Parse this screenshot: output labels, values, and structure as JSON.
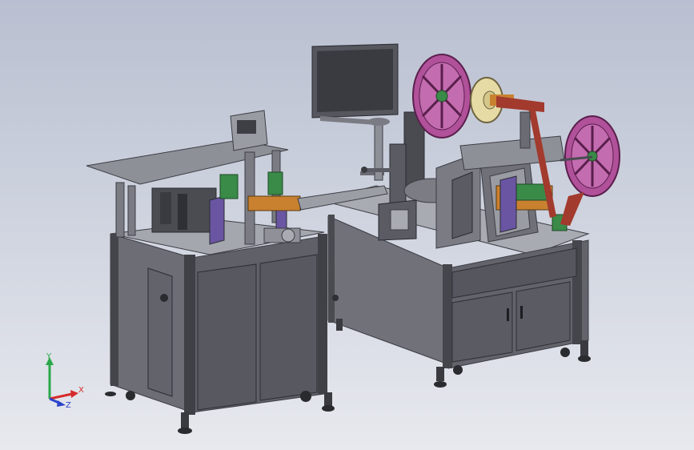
{
  "viewport": {
    "background_top": "#b9bfd0",
    "background_bottom": "#e7e9ee"
  },
  "model": {
    "body_color": "#6f7078",
    "frame_color": "#43444a",
    "reel_color": "#b0519a",
    "tape_color": "#e6dba5",
    "accent_orange": "#c9812f",
    "accent_purple": "#6a55a3",
    "accent_green": "#3a8a48",
    "accent_red": "#a23a2d"
  },
  "triad": {
    "x_label": "X",
    "y_label": "Y",
    "z_label": "Z",
    "x_color": "#d62b2b",
    "y_color": "#2aa84a",
    "z_color": "#2b44c9"
  }
}
